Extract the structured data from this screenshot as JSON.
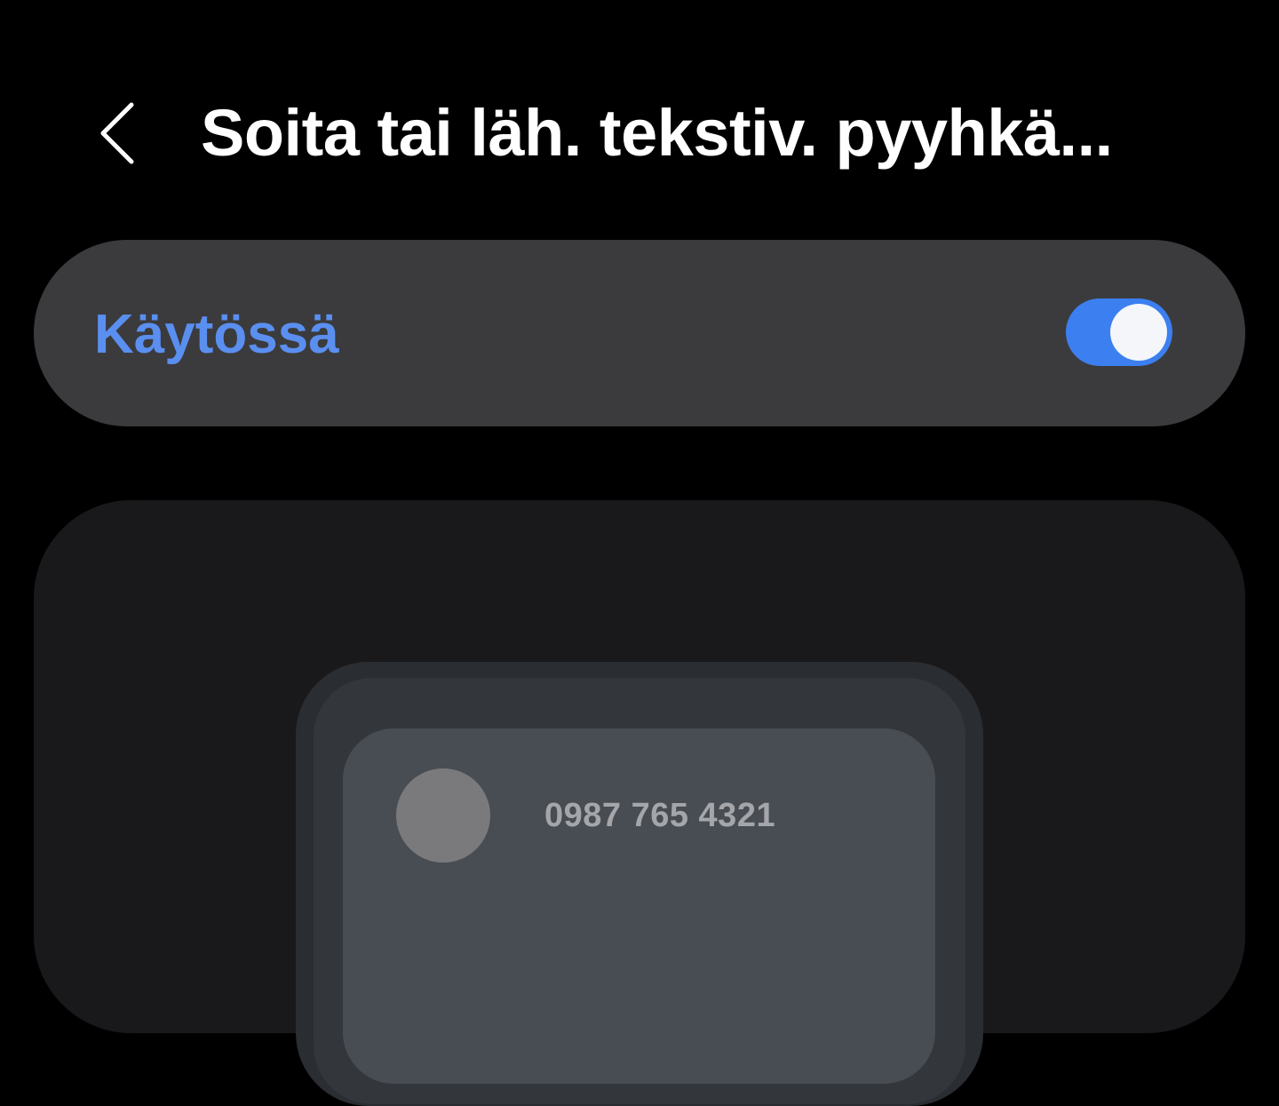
{
  "header": {
    "back_icon": "chevron-left-icon",
    "title": "Soita tai läh. tekstiv. pyyhkä..."
  },
  "master_toggle": {
    "label": "Käytössä",
    "state": "on",
    "accent_color": "#3c7ff0",
    "label_color": "#5a8ff0"
  },
  "preview": {
    "contact_number": "0987 765 4321"
  },
  "colors": {
    "background": "#000000",
    "card": "#3b3b3d",
    "preview_card": "#19191b"
  }
}
